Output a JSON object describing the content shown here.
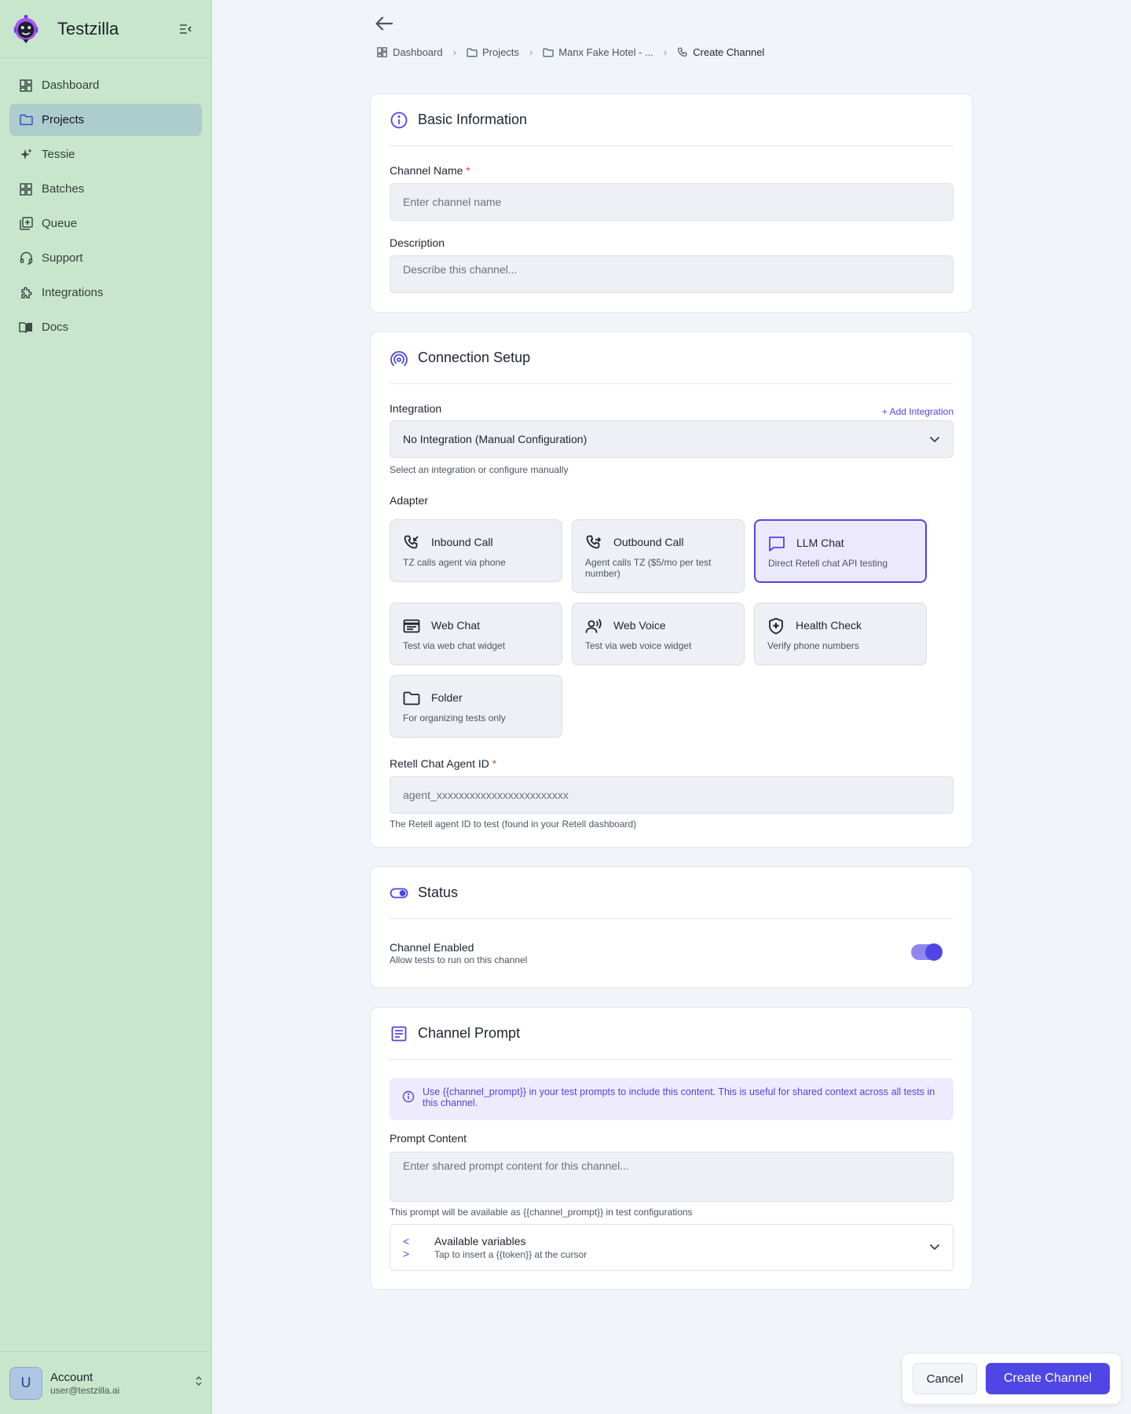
{
  "app": {
    "name": "Testzilla"
  },
  "sidebar": {
    "items": [
      {
        "label": "Dashboard",
        "icon": "dashboard-icon"
      },
      {
        "label": "Projects",
        "icon": "folder-icon",
        "active": true
      },
      {
        "label": "Tessie",
        "icon": "sparkle-icon"
      },
      {
        "label": "Batches",
        "icon": "grid-icon"
      },
      {
        "label": "Queue",
        "icon": "queue-icon"
      },
      {
        "label": "Support",
        "icon": "support-icon"
      },
      {
        "label": "Integrations",
        "icon": "puzzle-icon"
      },
      {
        "label": "Docs",
        "icon": "book-icon"
      }
    ],
    "account": {
      "initial": "U",
      "name": "Account",
      "email": "user@testzilla.ai"
    }
  },
  "breadcrumb": {
    "items": [
      {
        "label": "Dashboard",
        "icon": "dashboard-icon"
      },
      {
        "label": "Projects",
        "icon": "folder-icon"
      },
      {
        "label": "Manx Fake Hotel - ...",
        "icon": "folder-icon"
      },
      {
        "label": "Create Channel",
        "icon": "phone-icon"
      }
    ]
  },
  "basic_info": {
    "title": "Basic Information",
    "channel_name_label": "Channel Name",
    "required_mark": "*",
    "channel_name_placeholder": "Enter channel name",
    "description_label": "Description",
    "description_placeholder": "Describe this channel..."
  },
  "connection": {
    "title": "Connection Setup",
    "integration_label": "Integration",
    "add_integration": "+ Add Integration",
    "integration_value": "No Integration (Manual Configuration)",
    "integration_hint": "Select an integration or configure manually",
    "adapter_label": "Adapter",
    "adapters": [
      {
        "title": "Inbound Call",
        "desc": "TZ calls agent via phone",
        "icon": "phone-incoming-icon"
      },
      {
        "title": "Outbound Call",
        "desc": "Agent calls TZ ($5/mo per test number)",
        "icon": "phone-outgoing-icon"
      },
      {
        "title": "LLM Chat",
        "desc": "Direct Retell chat API testing",
        "icon": "chat-bubble-icon",
        "selected": true
      },
      {
        "title": "Web Chat",
        "desc": "Test via web chat widget",
        "icon": "browser-window-icon"
      },
      {
        "title": "Web Voice",
        "desc": "Test via web voice widget",
        "icon": "voice-icon"
      },
      {
        "title": "Health Check",
        "desc": "Verify phone numbers",
        "icon": "shield-plus-icon"
      },
      {
        "title": "Folder",
        "desc": "For organizing tests only",
        "icon": "folder-icon"
      }
    ],
    "agent_id_label": "Retell Chat Agent ID",
    "agent_id_placeholder": "agent_xxxxxxxxxxxxxxxxxxxxxxxx",
    "agent_id_hint": "The Retell agent ID to test (found in your Retell dashboard)"
  },
  "status": {
    "title": "Status",
    "enabled_label": "Channel Enabled",
    "enabled_desc": "Allow tests to run on this channel",
    "enabled": true
  },
  "prompt": {
    "title": "Channel Prompt",
    "info": "Use {{channel_prompt}} in your test prompts to include this content. This is useful for shared context across all tests in this channel.",
    "content_label": "Prompt Content",
    "content_placeholder": "Enter shared prompt content for this channel...",
    "content_hint": "This prompt will be available as {{channel_prompt}} in test configurations",
    "vars_title": "Available variables",
    "vars_sub": "Tap to insert a {{token}} at the cursor",
    "vars_icon": "< >"
  },
  "actions": {
    "cancel": "Cancel",
    "create": "Create Channel"
  },
  "colors": {
    "accent": "#4f46e5",
    "sidebar_bg": "#c8e6cb",
    "sidebar_active": "#acccce",
    "required": "#e5484d"
  }
}
